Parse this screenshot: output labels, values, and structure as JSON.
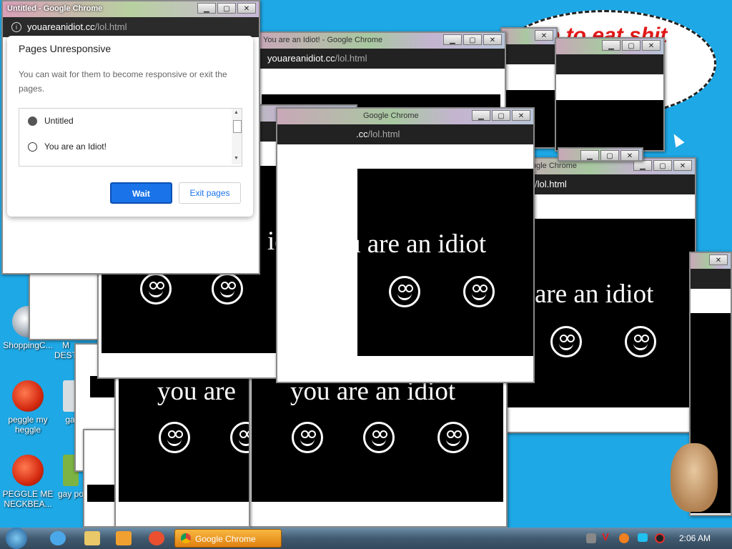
{
  "bubble_text": "me to eat shit\nw",
  "desktop_icons": [
    {
      "label": "ShoppingC..."
    },
    {
      "label": "M DEST"
    },
    {
      "label": "peggle my heggle"
    },
    {
      "label": "ga"
    },
    {
      "label": "PEGGLE ME NECKBEA..."
    },
    {
      "label": "gay po"
    }
  ],
  "main_window": {
    "title": "Untitled - Google Chrome",
    "url_domain": "youareanidiot.cc",
    "url_path": "/lol.html"
  },
  "windows": {
    "title_idiot": "You are an Idiot! - Google Chrome",
    "title_short": "Google Chrome",
    "title_tiny": "ogle Chrome",
    "url_domain": "youareanidiot.cc",
    "url_path": "/lol.html",
    "url_frag1": ".cc",
    "url_frag2": "/lol.html",
    "text_idiot": "idiot",
    "text_full": "u are an idiot",
    "text_are": "are an idiot",
    "text_you": "you are",
    "text_you_full": "you are an idiot"
  },
  "window_controls": {
    "minimize": "▁",
    "maximize": "▢",
    "close": "✕"
  },
  "dialog": {
    "title": "Pages Unresponsive",
    "message": "You can wait for them to become responsive or exit the pages.",
    "pages": [
      {
        "label": "Untitled",
        "icon": "globe-icon"
      },
      {
        "label": "You are an Idiot!",
        "icon": "smiley-icon"
      }
    ],
    "wait_label": "Wait",
    "exit_label": "Exit pages"
  },
  "taskbar": {
    "active_task": "Google Chrome",
    "clock": "2:06 AM"
  },
  "colors": {
    "desktop": "#1ea8e6",
    "accent": "#1a73e8",
    "bubble_text": "#e21818",
    "taskbar_task": "#f0a030"
  }
}
